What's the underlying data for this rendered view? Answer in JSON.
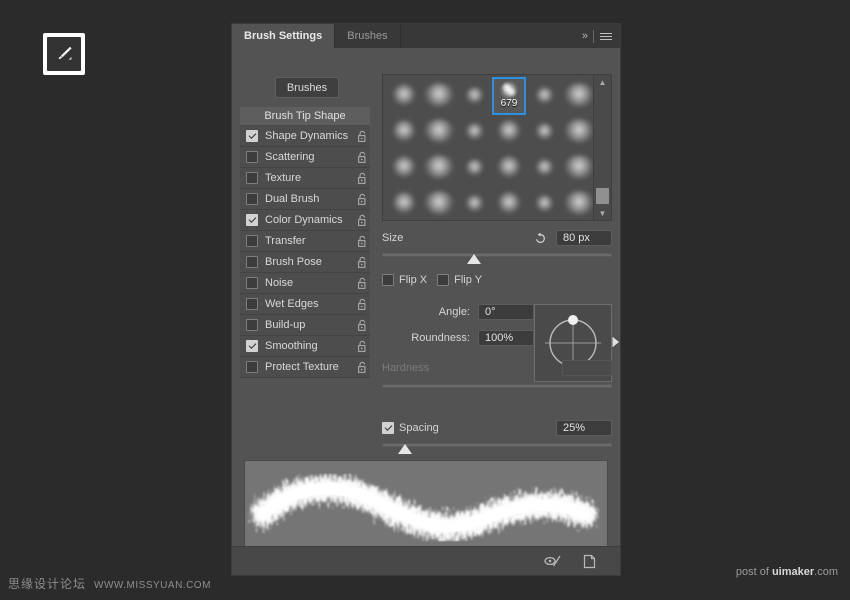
{
  "tool_badge": {
    "icon": "paintbrush-icon"
  },
  "panel": {
    "tabs": [
      {
        "label": "Brush Settings",
        "active": true
      },
      {
        "label": "Brushes",
        "active": false
      }
    ],
    "collapse_icon": "chevron-double-right-icon",
    "menu_icon": "hamburger-menu-icon",
    "brushes_button": "Brushes",
    "list_header": "Brush Tip Shape",
    "settings": [
      {
        "label": "Shape Dynamics",
        "checked": true,
        "lock": "unlock-icon"
      },
      {
        "label": "Scattering",
        "checked": false,
        "lock": "unlock-icon"
      },
      {
        "label": "Texture",
        "checked": false,
        "lock": "unlock-icon"
      },
      {
        "label": "Dual Brush",
        "checked": false,
        "lock": "unlock-icon"
      },
      {
        "label": "Color Dynamics",
        "checked": true,
        "lock": "unlock-icon"
      },
      {
        "label": "Transfer",
        "checked": false,
        "lock": "unlock-icon"
      },
      {
        "label": "Brush Pose",
        "checked": false,
        "lock": "unlock-icon"
      },
      {
        "label": "Noise",
        "checked": false,
        "lock": "unlock-icon"
      },
      {
        "label": "Wet Edges",
        "checked": false,
        "lock": "unlock-icon"
      },
      {
        "label": "Build-up",
        "checked": false,
        "lock": "unlock-icon"
      },
      {
        "label": "Smoothing",
        "checked": true,
        "lock": "unlock-icon"
      },
      {
        "label": "Protect Texture",
        "checked": false,
        "lock": "unlock-icon"
      }
    ],
    "brush_grid": {
      "selected_brush_number": "679",
      "selection_color": "#2f8fe0",
      "columns": 6,
      "rows": 4,
      "scrollbar": {
        "up_icon": "chevron-up-icon",
        "down_icon": "chevron-down-icon",
        "thumb_position": "bottom"
      }
    },
    "size": {
      "label": "Size",
      "reset_icon": "reset-arrow-icon",
      "value": "80 px",
      "slider_percent": 40
    },
    "flip": {
      "flip_x_label": "Flip X",
      "flip_x_checked": false,
      "flip_y_label": "Flip Y",
      "flip_y_checked": false
    },
    "angle": {
      "label": "Angle:",
      "value": "0°"
    },
    "roundness": {
      "label": "Roundness:",
      "value": "100%"
    },
    "hardness": {
      "label": "Hardness",
      "value": "",
      "disabled": true,
      "slider_percent": 0
    },
    "spacing": {
      "label": "Spacing",
      "checked": true,
      "value": "25%",
      "slider_percent": 10
    },
    "dial": {
      "name": "angle-roundness-dial",
      "arrow_icon": "angle-pointer-icon"
    },
    "footer": {
      "toggle_icon": "brush-stroke-toggle-icon",
      "new_brush_icon": "new-brush-preset-icon"
    }
  },
  "watermarks": {
    "left_cn": "思缘设计论坛",
    "left_en": "WWW.MISSYUAN.COM",
    "right_prefix": "post of ",
    "right_brand": "uimaker",
    "right_suffix": ".com"
  },
  "colors": {
    "app_background": "#2b2b2b",
    "panel_background": "#535353",
    "tabstrip_background": "#383838",
    "accent_blue": "#2f8fe0",
    "stroke_preview_background": "#757575"
  }
}
